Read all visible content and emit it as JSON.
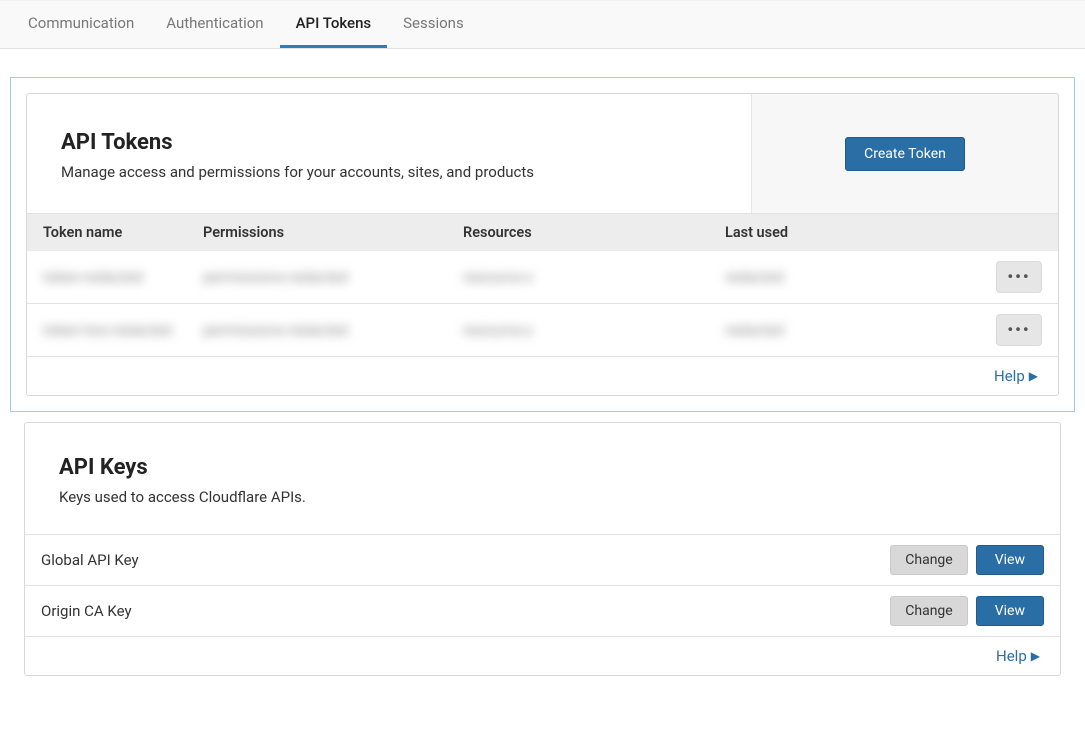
{
  "tabs": {
    "items": [
      {
        "label": "Communication",
        "active": false
      },
      {
        "label": "Authentication",
        "active": false
      },
      {
        "label": "API Tokens",
        "active": true
      },
      {
        "label": "Sessions",
        "active": false
      }
    ]
  },
  "tokens": {
    "title": "API Tokens",
    "subtitle": "Manage access and permissions for your accounts, sites, and products",
    "create_label": "Create Token",
    "columns": {
      "name": "Token name",
      "permissions": "Permissions",
      "resources": "Resources",
      "last_used": "Last used"
    },
    "rows": [
      {
        "name": "token-redacted",
        "permissions": "permissions-redacted",
        "resources": "resource-x",
        "last_used": "redacted"
      },
      {
        "name": "token-two-redacted",
        "permissions": "permissions-redacted",
        "resources": "resource-y",
        "last_used": "redacted"
      }
    ],
    "help_label": "Help"
  },
  "keys": {
    "title": "API Keys",
    "subtitle": "Keys used to access Cloudflare APIs.",
    "items": [
      {
        "name": "Global API Key"
      },
      {
        "name": "Origin CA Key"
      }
    ],
    "change_label": "Change",
    "view_label": "View",
    "help_label": "Help"
  }
}
